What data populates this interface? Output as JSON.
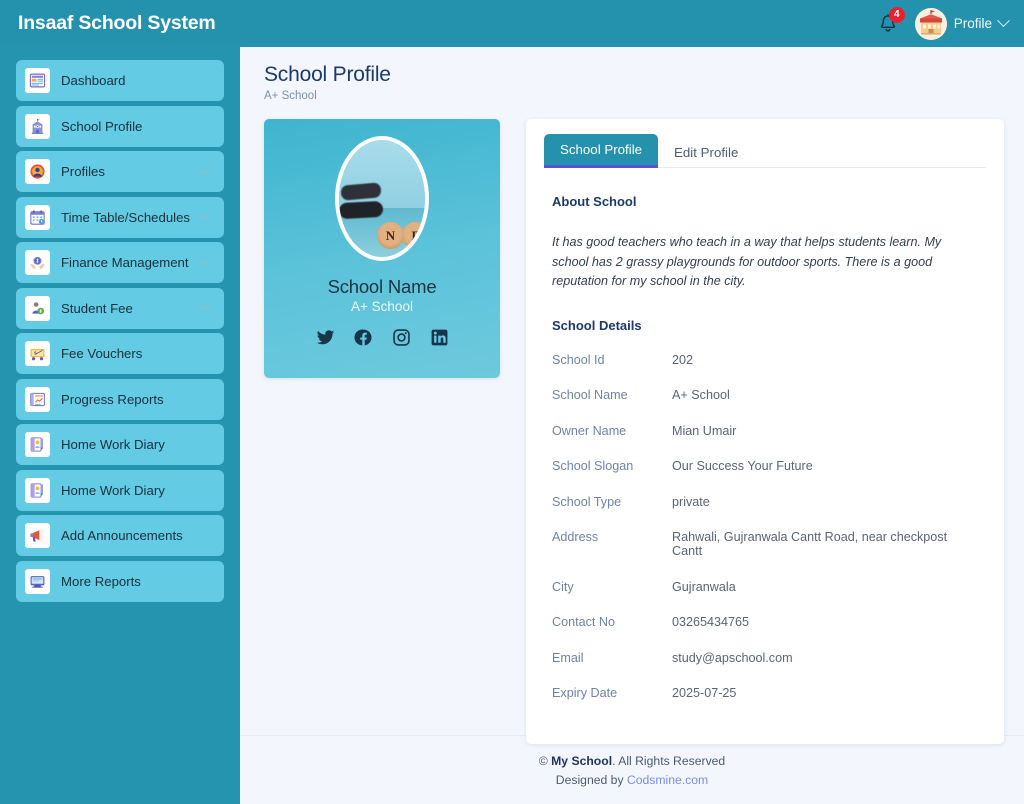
{
  "header": {
    "brand": "Insaaf School System",
    "notification_count": "4",
    "profile_label": "Profile",
    "bell_icon": "bell-icon",
    "avatar_icon": "school-building-avatar",
    "chevron_icon": "chevron-down-icon"
  },
  "sidebar": {
    "items": [
      {
        "label": "Dashboard",
        "icon": "dashboard-icon",
        "expandable": false
      },
      {
        "label": "School Profile",
        "icon": "school-icon",
        "expandable": false
      },
      {
        "label": "Profiles",
        "icon": "user-circle-icon",
        "expandable": true
      },
      {
        "label": "Time Table/Schedules",
        "icon": "calendar-icon",
        "expandable": true
      },
      {
        "label": "Finance Management",
        "icon": "finance-icon",
        "expandable": true
      },
      {
        "label": "Student Fee",
        "icon": "student-fee-icon",
        "expandable": true
      },
      {
        "label": "Fee Vouchers",
        "icon": "voucher-icon",
        "expandable": false
      },
      {
        "label": "Progress Reports",
        "icon": "report-chart-icon",
        "expandable": false
      },
      {
        "label": "Home Work Diary",
        "icon": "diary-icon",
        "expandable": false
      },
      {
        "label": "Home Work Diary",
        "icon": "diary-icon",
        "expandable": false
      },
      {
        "label": "Add Announcements",
        "icon": "megaphone-icon",
        "expandable": false
      },
      {
        "label": "More Reports",
        "icon": "monitor-icon",
        "expandable": false
      }
    ]
  },
  "page": {
    "title": "School Profile",
    "subtitle": "A+ School"
  },
  "profile_card": {
    "avatar_alt": "school-photo",
    "avatar_letters": [
      "N",
      "F"
    ],
    "name": "School Name",
    "subtitle": "A+ School",
    "socials": [
      {
        "name": "twitter-icon"
      },
      {
        "name": "facebook-icon"
      },
      {
        "name": "instagram-icon"
      },
      {
        "name": "linkedin-icon"
      }
    ]
  },
  "detail_card": {
    "tabs": [
      {
        "label": "School Profile",
        "active": true
      },
      {
        "label": "Edit Profile",
        "active": false
      }
    ],
    "about_heading": "About School",
    "about_text": "It has good teachers who teach in a way that helps students learn. My school has 2 grassy playgrounds for outdoor sports. There is a good reputation for my school in the city.",
    "details_heading": "School Details",
    "details": [
      {
        "key": "School Id",
        "value": "202"
      },
      {
        "key": "School Name",
        "value": "A+ School"
      },
      {
        "key": "Owner Name",
        "value": "Mian Umair"
      },
      {
        "key": "School Slogan",
        "value": "Our Success Your Future"
      },
      {
        "key": "School Type",
        "value": "private"
      },
      {
        "key": "Address",
        "value": "Rahwali, Gujranwala Cantt Road, near checkpost Cantt"
      },
      {
        "key": "City",
        "value": "Gujranwala"
      },
      {
        "key": "Contact No",
        "value": "03265434765"
      },
      {
        "key": "Email",
        "value": "study@apschool.com"
      },
      {
        "key": "Expiry Date",
        "value": "2025-07-25"
      }
    ]
  },
  "footer": {
    "copyright_symbol": "©",
    "brand": "My School",
    "rights": ". All Rights Reserved",
    "designed_prefix": "Designed by ",
    "designer": "Codsmine.com"
  },
  "colors": {
    "header_bg": "#2492ad",
    "sidebar_bg": "#2594ae",
    "nav_item_bg": "#63cbe3",
    "main_bg": "#f3f7fd",
    "accent_teal": "#2492ad",
    "tab_underline": "#5a4fd6",
    "badge_red": "#e8212f",
    "title_navy": "#1b3a6b",
    "key_blue": "#6f83a6",
    "link_purple": "#7b8ce0"
  }
}
